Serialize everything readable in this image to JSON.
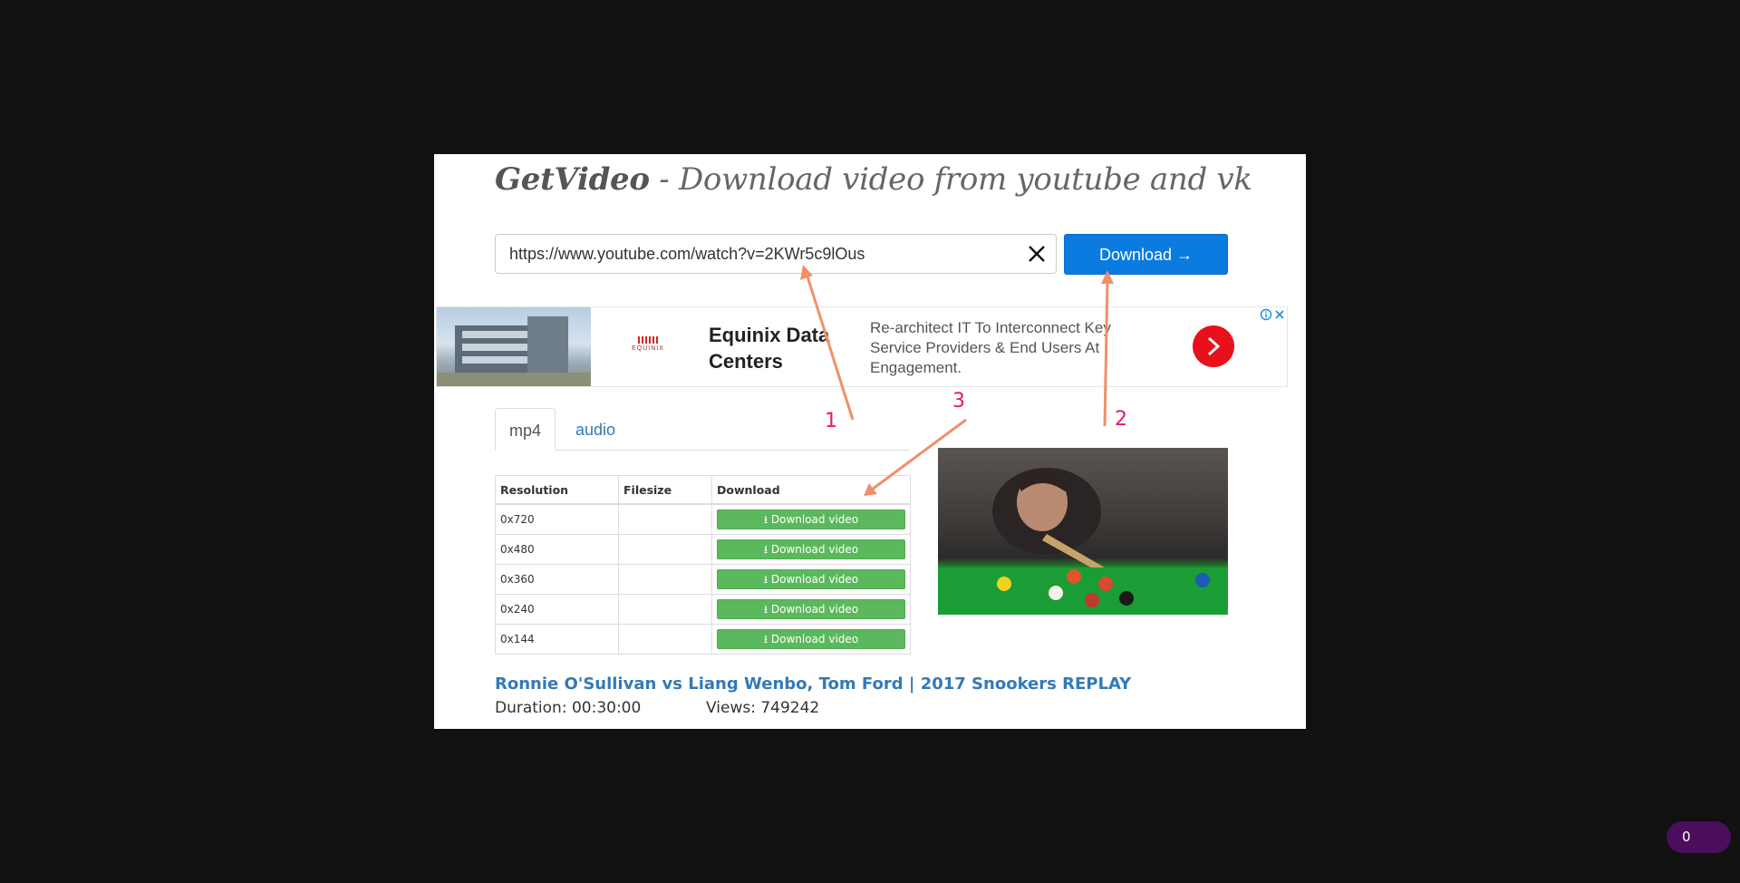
{
  "header": {
    "brand": "GetVideo",
    "tagline": " - Download video from youtube and vk"
  },
  "search": {
    "url_value": "https://www.youtube.com/watch?v=2KWr5c9lOus",
    "download_label": "Download →"
  },
  "ad": {
    "logo_text": "EQUINIX",
    "headline": "Equinix Data Centers",
    "body": "Re-architect IT To Interconnect Key Service Providers & End Users At Engagement."
  },
  "tabs": [
    {
      "label": "mp4"
    },
    {
      "label": "audio"
    }
  ],
  "table": {
    "headers": [
      "Resolution",
      "Filesize",
      "Download"
    ],
    "rows": [
      {
        "resolution": "0x720",
        "filesize": "",
        "button": "Download video"
      },
      {
        "resolution": "0x480",
        "filesize": "",
        "button": "Download video"
      },
      {
        "resolution": "0x360",
        "filesize": "",
        "button": "Download video"
      },
      {
        "resolution": "0x240",
        "filesize": "",
        "button": "Download video"
      },
      {
        "resolution": "0x144",
        "filesize": "",
        "button": "Download video"
      }
    ]
  },
  "video": {
    "title": "Ronnie O'Sullivan vs Liang Wenbo, Tom Ford | 2017 Snookers REPLAY",
    "duration": "Duration: 00:30:00",
    "views": "Views: 749242"
  },
  "annotations": [
    "1",
    "2",
    "3"
  ],
  "counter": {
    "value": "0"
  },
  "colors": {
    "primary_button": "#0b7be0",
    "success_button": "#5cb85c",
    "link": "#337ab7",
    "annotation_arrow": "#f0906a",
    "annotation_number": "#e6196b",
    "backdrop": "#111111",
    "counter_pill": "#4b0d5c"
  }
}
